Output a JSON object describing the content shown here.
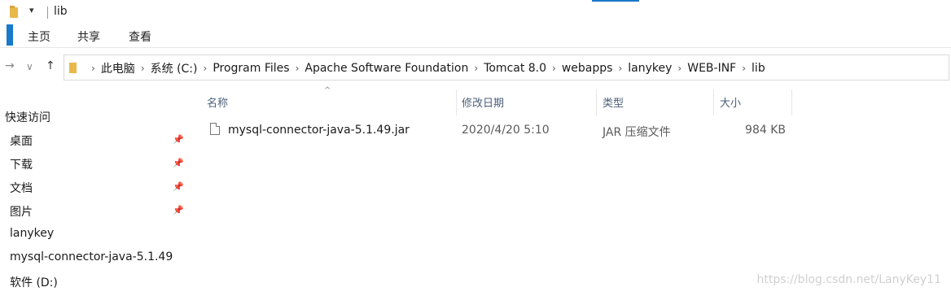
{
  "titlebar": {
    "title": "lib",
    "dropdown": "▾"
  },
  "ribbon": {
    "tabs": [
      "主页",
      "共享",
      "查看"
    ]
  },
  "nav": {
    "back": "→",
    "dropdown": "∨",
    "up": "↑"
  },
  "address": {
    "crumbs": [
      "此电脑",
      "系统 (C:)",
      "Program Files",
      "Apache Software Foundation",
      "Tomcat 8.0",
      "webapps",
      "lanykey",
      "WEB-INF",
      "lib"
    ],
    "separator": "›"
  },
  "sidebar": {
    "header": "快速访问",
    "items": [
      {
        "label": "桌面",
        "pinned": true
      },
      {
        "label": "下载",
        "pinned": true
      },
      {
        "label": "文档",
        "pinned": true
      },
      {
        "label": "图片",
        "pinned": true
      },
      {
        "label": "lanykey",
        "pinned": false
      },
      {
        "label": "mysql-connector-java-5.1.49",
        "pinned": false
      },
      {
        "label": "软件 (D:)",
        "pinned": false
      }
    ],
    "pin_glyph": "📌"
  },
  "columns": {
    "sort": "^",
    "name": "名称",
    "date": "修改日期",
    "type": "类型",
    "size": "大小"
  },
  "files": [
    {
      "name": "mysql-connector-java-5.1.49.jar",
      "date": "2020/4/20 5:10",
      "type": "JAR 压缩文件",
      "size": "984 KB"
    }
  ],
  "watermark": "https://blog.csdn.net/LanyKey11"
}
